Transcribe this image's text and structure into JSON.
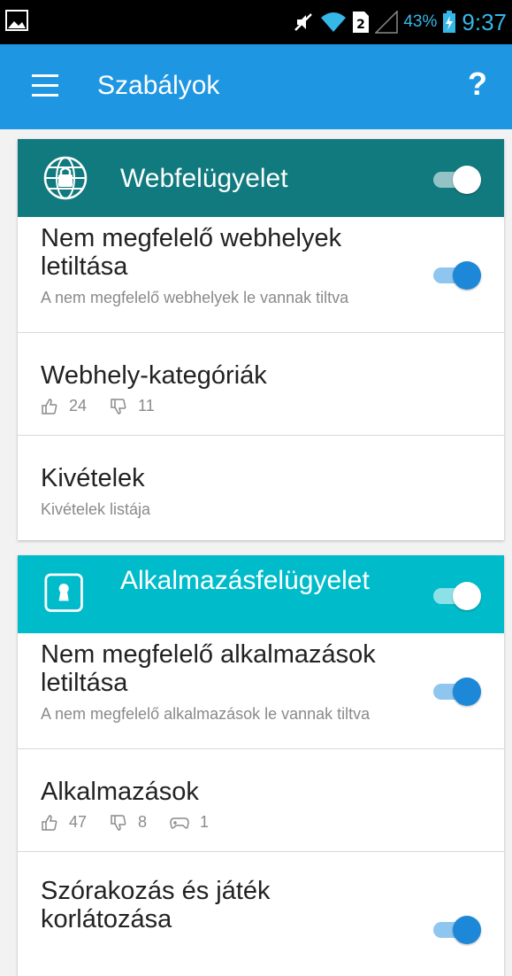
{
  "status_bar": {
    "battery_percent": "43%",
    "time": "9:37"
  },
  "app_bar": {
    "title": "Szabályok",
    "help_label": "?"
  },
  "colors": {
    "app_bar": "#1e96e2",
    "web_header": "#117a7e",
    "apps_header": "#00bcca",
    "toggle_on": "#1e88d8"
  },
  "web_card": {
    "title": "Webfelügyelet",
    "enabled": true,
    "items": [
      {
        "title": "Nem megfelelő webhelyek letiltása",
        "subtitle": "A nem megfelelő webhelyek le vannak tiltva",
        "enabled": true
      },
      {
        "title": "Webhely-kategóriák",
        "allowed_count": "24",
        "blocked_count": "11"
      },
      {
        "title": "Kivételek",
        "subtitle": "Kivételek listája"
      }
    ]
  },
  "apps_card": {
    "title": "Alkalmazásfelügyelet",
    "enabled": true,
    "items": [
      {
        "title": "Nem megfelelő alkalmazások letiltása",
        "subtitle": "A nem megfelelő alkalmazások le vannak tiltva",
        "enabled": true
      },
      {
        "title": "Alkalmazások",
        "allowed_count": "47",
        "blocked_count": "8",
        "games_count": "1"
      },
      {
        "title": "Szórakozás és játék korlátozása",
        "enabled": true
      }
    ]
  }
}
